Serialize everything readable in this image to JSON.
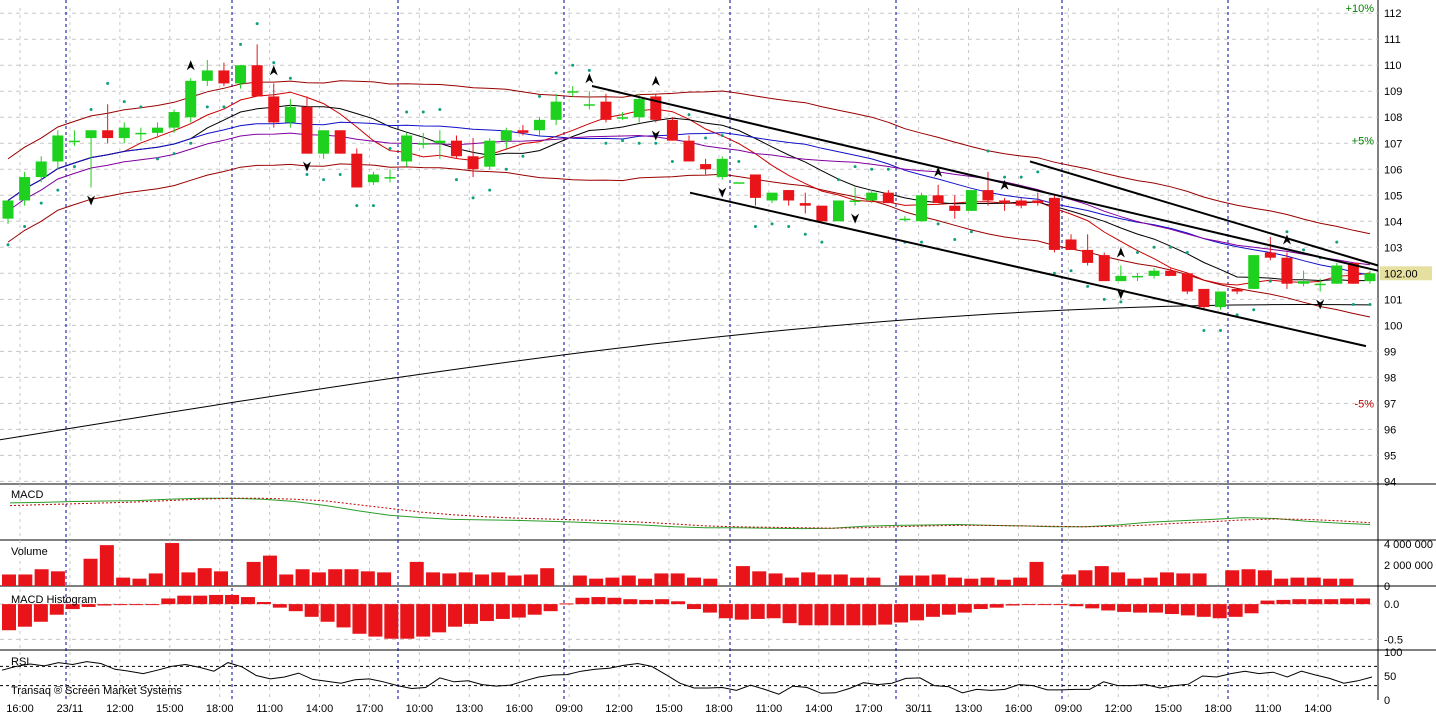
{
  "watermark": "Transaq ® Screen Market Systems",
  "colors": {
    "up": "#1fd11f",
    "down": "#e8141a",
    "grid": "#c8c8c8",
    "vgrid": "#0000a0",
    "price_tag_bg": "#e6e0a0",
    "ma_long": "#000000",
    "pct_pos": "#008000",
    "pct_neg": "#c00000"
  },
  "chart_data": [
    {
      "type": "candlestick",
      "name": "price",
      "x_labels": [
        "16:00",
        "23/11",
        "12:00",
        "15:00",
        "18:00",
        "11:00",
        "14:00",
        "17:00",
        "10:00",
        "13:00",
        "16:00",
        "09:00",
        "12:00",
        "15:00",
        "18:00",
        "11:00",
        "14:00",
        "17:00",
        "30/11",
        "13:00",
        "16:00",
        "09:00",
        "12:00",
        "15:00",
        "18:00",
        "11:00",
        "14:00"
      ],
      "y_ticks": [
        94,
        95,
        96,
        97,
        98,
        99,
        100,
        101,
        102,
        103,
        104,
        105,
        106,
        107,
        108,
        109,
        110,
        111,
        112
      ],
      "ylim": [
        93.9,
        112.2
      ],
      "last_price_label": "102.00",
      "pct_labels": [
        {
          "label": "+10%",
          "value": 112.2,
          "tone": "pos"
        },
        {
          "label": "+5%",
          "value": 107.1,
          "tone": "pos"
        },
        {
          "label": "-5%",
          "value": 97.0,
          "tone": "neg"
        }
      ],
      "candles": [
        {
          "o": 104.1,
          "h": 104.5,
          "l": 103.9,
          "c": 104.8
        },
        {
          "o": 104.8,
          "h": 105.9,
          "l": 104.6,
          "c": 105.7
        },
        {
          "o": 105.7,
          "h": 106.5,
          "l": 105.5,
          "c": 106.3
        },
        {
          "o": 106.3,
          "h": 107.5,
          "l": 106.0,
          "c": 107.3
        },
        {
          "o": 107.1,
          "h": 107.5,
          "l": 106.9,
          "c": 107.1
        },
        {
          "o": 107.2,
          "h": 107.5,
          "l": 105.3,
          "c": 107.5
        },
        {
          "o": 107.5,
          "h": 108.5,
          "l": 107.0,
          "c": 107.2
        },
        {
          "o": 107.2,
          "h": 107.8,
          "l": 107.0,
          "c": 107.6
        },
        {
          "o": 107.4,
          "h": 107.6,
          "l": 107.1,
          "c": 107.4
        },
        {
          "o": 107.4,
          "h": 107.8,
          "l": 107.2,
          "c": 107.6
        },
        {
          "o": 107.6,
          "h": 108.3,
          "l": 107.4,
          "c": 108.2
        },
        {
          "o": 108.0,
          "h": 109.5,
          "l": 107.8,
          "c": 109.4
        },
        {
          "o": 109.4,
          "h": 110.2,
          "l": 109.2,
          "c": 109.8
        },
        {
          "o": 109.8,
          "h": 110.1,
          "l": 109.2,
          "c": 109.3
        },
        {
          "o": 109.3,
          "h": 110.0,
          "l": 109.1,
          "c": 110.0
        },
        {
          "o": 110.0,
          "h": 110.8,
          "l": 108.8,
          "c": 108.8
        },
        {
          "o": 108.8,
          "h": 109.3,
          "l": 107.6,
          "c": 107.8
        },
        {
          "o": 107.8,
          "h": 108.7,
          "l": 107.6,
          "c": 108.4
        },
        {
          "o": 108.4,
          "h": 108.8,
          "l": 106.6,
          "c": 106.6
        },
        {
          "o": 106.6,
          "h": 107.5,
          "l": 106.4,
          "c": 107.5
        },
        {
          "o": 107.5,
          "h": 107.5,
          "l": 106.6,
          "c": 106.6
        },
        {
          "o": 106.6,
          "h": 106.8,
          "l": 105.4,
          "c": 105.3
        },
        {
          "o": 105.5,
          "h": 105.9,
          "l": 105.4,
          "c": 105.8
        },
        {
          "o": 105.7,
          "h": 106.0,
          "l": 105.5,
          "c": 105.7
        },
        {
          "o": 106.3,
          "h": 107.4,
          "l": 106.1,
          "c": 107.3
        },
        {
          "o": 107.0,
          "h": 107.4,
          "l": 106.8,
          "c": 107.0
        },
        {
          "o": 107.0,
          "h": 107.5,
          "l": 106.4,
          "c": 107.1
        },
        {
          "o": 107.1,
          "h": 107.3,
          "l": 106.4,
          "c": 106.5
        },
        {
          "o": 106.5,
          "h": 107.2,
          "l": 105.7,
          "c": 106.0
        },
        {
          "o": 106.1,
          "h": 107.2,
          "l": 106.0,
          "c": 107.1
        },
        {
          "o": 107.1,
          "h": 107.6,
          "l": 106.8,
          "c": 107.5
        },
        {
          "o": 107.5,
          "h": 107.7,
          "l": 107.3,
          "c": 107.4
        },
        {
          "o": 107.5,
          "h": 108.0,
          "l": 107.3,
          "c": 107.9
        },
        {
          "o": 107.9,
          "h": 108.9,
          "l": 107.7,
          "c": 108.6
        },
        {
          "o": 109.0,
          "h": 109.2,
          "l": 108.8,
          "c": 109.0
        },
        {
          "o": 108.5,
          "h": 109.0,
          "l": 108.3,
          "c": 108.5
        },
        {
          "o": 108.6,
          "h": 108.9,
          "l": 107.8,
          "c": 107.9
        },
        {
          "o": 108.0,
          "h": 108.2,
          "l": 107.9,
          "c": 108.0
        },
        {
          "o": 108.0,
          "h": 108.9,
          "l": 107.8,
          "c": 108.7
        },
        {
          "o": 108.8,
          "h": 108.9,
          "l": 107.8,
          "c": 107.9
        },
        {
          "o": 107.9,
          "h": 108.0,
          "l": 107.1,
          "c": 107.1
        },
        {
          "o": 107.1,
          "h": 107.3,
          "l": 106.3,
          "c": 106.3
        },
        {
          "o": 106.2,
          "h": 106.4,
          "l": 105.8,
          "c": 106.0
        },
        {
          "o": 105.7,
          "h": 106.5,
          "l": 105.6,
          "c": 106.4
        },
        {
          "o": 105.5,
          "h": 105.5,
          "l": 105.5,
          "c": 105.5
        },
        {
          "o": 105.8,
          "h": 105.8,
          "l": 104.6,
          "c": 104.9
        },
        {
          "o": 104.8,
          "h": 105.1,
          "l": 104.7,
          "c": 105.1
        },
        {
          "o": 105.2,
          "h": 105.2,
          "l": 104.6,
          "c": 104.8
        },
        {
          "o": 104.7,
          "h": 105.1,
          "l": 104.3,
          "c": 104.6
        },
        {
          "o": 104.6,
          "h": 104.6,
          "l": 104.0,
          "c": 104.0
        },
        {
          "o": 104.0,
          "h": 104.8,
          "l": 104.0,
          "c": 104.8
        },
        {
          "o": 104.8,
          "h": 105.3,
          "l": 104.6,
          "c": 104.8
        },
        {
          "o": 104.8,
          "h": 105.2,
          "l": 104.7,
          "c": 105.1
        },
        {
          "o": 105.1,
          "h": 105.2,
          "l": 104.7,
          "c": 104.7
        },
        {
          "o": 104.1,
          "h": 104.2,
          "l": 104.0,
          "c": 104.1
        },
        {
          "o": 104.0,
          "h": 105.1,
          "l": 104.0,
          "c": 105.0
        },
        {
          "o": 105.0,
          "h": 105.4,
          "l": 104.7,
          "c": 104.7
        },
        {
          "o": 104.6,
          "h": 105.0,
          "l": 104.1,
          "c": 104.4
        },
        {
          "o": 104.4,
          "h": 105.2,
          "l": 104.4,
          "c": 105.2
        },
        {
          "o": 105.2,
          "h": 105.9,
          "l": 104.6,
          "c": 104.8
        },
        {
          "o": 104.8,
          "h": 104.9,
          "l": 104.4,
          "c": 104.7
        },
        {
          "o": 104.8,
          "h": 104.9,
          "l": 104.5,
          "c": 104.6
        },
        {
          "o": 104.8,
          "h": 105.1,
          "l": 104.6,
          "c": 104.7
        },
        {
          "o": 104.9,
          "h": 105.0,
          "l": 102.8,
          "c": 102.9
        },
        {
          "o": 103.3,
          "h": 103.5,
          "l": 102.9,
          "c": 102.9
        },
        {
          "o": 102.9,
          "h": 103.5,
          "l": 102.3,
          "c": 102.4
        },
        {
          "o": 102.7,
          "h": 102.8,
          "l": 101.8,
          "c": 101.7
        },
        {
          "o": 101.7,
          "h": 102.3,
          "l": 101.7,
          "c": 101.9
        },
        {
          "o": 101.9,
          "h": 102.0,
          "l": 101.7,
          "c": 101.9
        },
        {
          "o": 101.9,
          "h": 102.2,
          "l": 101.8,
          "c": 102.1
        },
        {
          "o": 102.1,
          "h": 102.2,
          "l": 101.9,
          "c": 101.9
        },
        {
          "o": 102.0,
          "h": 102.0,
          "l": 101.2,
          "c": 101.3
        },
        {
          "o": 101.4,
          "h": 101.4,
          "l": 100.6,
          "c": 100.7
        },
        {
          "o": 100.7,
          "h": 101.3,
          "l": 100.6,
          "c": 101.3
        },
        {
          "o": 101.4,
          "h": 101.3,
          "l": 101.2,
          "c": 101.3
        },
        {
          "o": 101.4,
          "h": 102.7,
          "l": 101.4,
          "c": 102.7
        },
        {
          "o": 102.8,
          "h": 103.4,
          "l": 102.5,
          "c": 102.6
        },
        {
          "o": 102.6,
          "h": 102.8,
          "l": 101.4,
          "c": 101.6
        },
        {
          "o": 101.6,
          "h": 102.1,
          "l": 101.5,
          "c": 101.7
        },
        {
          "o": 101.6,
          "h": 101.8,
          "l": 101.3,
          "c": 101.6
        },
        {
          "o": 101.6,
          "h": 102.4,
          "l": 101.6,
          "c": 102.3
        },
        {
          "o": 102.4,
          "h": 102.4,
          "l": 101.6,
          "c": 101.6
        },
        {
          "o": 101.7,
          "h": 102.1,
          "l": 101.6,
          "c": 102.0
        }
      ],
      "trendlines": [
        {
          "x0": 592,
          "y0": 109.2,
          "x1": 1378,
          "y1": 102.1
        },
        {
          "x0": 690,
          "y0": 105.1,
          "x1": 1366,
          "y1": 99.2
        },
        {
          "x0": 1030,
          "y0": 106.3,
          "x1": 1378,
          "y1": 102.3
        }
      ],
      "fractal_up_at": [
        11,
        16,
        35,
        39,
        56,
        60,
        67,
        77
      ],
      "fractal_down_at": [
        5,
        18,
        39,
        43,
        51,
        67,
        79,
        90
      ]
    },
    {
      "type": "line",
      "name": "MACD",
      "label": "MACD",
      "series": [
        {
          "name": "macd",
          "values": [
            0.72,
            0.73,
            0.75,
            0.76,
            0.77,
            0.8,
            0.82,
            0.82,
            0.8,
            0.75,
            0.66,
            0.55,
            0.45,
            0.4,
            0.36,
            0.35,
            0.34,
            0.32,
            0.3,
            0.27,
            0.24,
            0.2,
            0.18,
            0.18,
            0.17,
            0.16,
            0.17,
            0.21,
            0.23,
            0.24,
            0.25,
            0.23,
            0.22,
            0.2,
            0.2,
            0.24,
            0.3,
            0.33,
            0.36,
            0.4,
            0.38,
            0.32,
            0.28,
            0.25
          ]
        },
        {
          "name": "signal",
          "values": [
            0.66,
            0.68,
            0.7,
            0.72,
            0.74,
            0.77,
            0.8,
            0.82,
            0.82,
            0.8,
            0.76,
            0.68,
            0.6,
            0.52,
            0.46,
            0.42,
            0.39,
            0.37,
            0.35,
            0.33,
            0.3,
            0.26,
            0.22,
            0.2,
            0.19,
            0.18,
            0.17,
            0.18,
            0.2,
            0.22,
            0.23,
            0.23,
            0.22,
            0.21,
            0.2,
            0.21,
            0.24,
            0.28,
            0.31,
            0.35,
            0.37,
            0.36,
            0.33,
            0.29
          ]
        }
      ]
    },
    {
      "type": "bar",
      "name": "Volume",
      "label": "Volume",
      "y_ticks": [
        {
          "value": 0,
          "label": "0"
        },
        {
          "value": 2000000,
          "label": "2 000 000"
        },
        {
          "value": 4000000,
          "label": "4 000 000"
        }
      ],
      "ylim": [
        0,
        4200000
      ],
      "values": [
        1100000,
        1100000,
        1600000,
        1400000,
        0,
        2600000,
        3900000,
        800000,
        700000,
        1200000,
        4100000,
        1300000,
        1700000,
        1400000,
        0,
        2300000,
        2900000,
        1100000,
        1600000,
        1300000,
        1600000,
        1600000,
        1400000,
        1300000,
        0,
        2300000,
        1300000,
        1200000,
        1300000,
        1100000,
        1300000,
        1000000,
        1100000,
        1700000,
        0,
        1000000,
        700000,
        800000,
        1000000,
        700000,
        1200000,
        1200000,
        800000,
        700000,
        0,
        1900000,
        1400000,
        1200000,
        800000,
        1300000,
        1100000,
        1100000,
        800000,
        800000,
        0,
        1000000,
        1000000,
        1100000,
        800000,
        700000,
        800000,
        600000,
        800000,
        2300000,
        0,
        1100000,
        1500000,
        1900000,
        1300000,
        700000,
        800000,
        1300000,
        1200000,
        1200000,
        0,
        1500000,
        1600000,
        1500000,
        700000,
        800000,
        800000,
        700000,
        700000,
        0
      ],
      "values_unit": "shares"
    },
    {
      "type": "bar",
      "name": "MACD Histogram",
      "label": "MACD Histogram",
      "y_ticks": [
        {
          "value": 0.0,
          "label": "0.0"
        },
        {
          "value": -0.5,
          "label": "-0.5"
        }
      ],
      "ylim": [
        -0.65,
        0.2
      ],
      "values": [
        -0.37,
        -0.32,
        -0.25,
        -0.15,
        -0.07,
        -0.04,
        -0.02,
        -0.01,
        -0.01,
        -0.01,
        0.08,
        0.12,
        0.12,
        0.13,
        0.13,
        0.1,
        0.03,
        -0.05,
        -0.1,
        -0.18,
        -0.25,
        -0.33,
        -0.42,
        -0.46,
        -0.49,
        -0.49,
        -0.46,
        -0.4,
        -0.32,
        -0.28,
        -0.24,
        -0.21,
        -0.19,
        -0.15,
        -0.1,
        0.01,
        0.09,
        0.1,
        0.09,
        0.07,
        0.06,
        0.07,
        0.04,
        -0.07,
        -0.12,
        -0.2,
        -0.22,
        -0.21,
        -0.2,
        -0.27,
        -0.3,
        -0.3,
        -0.3,
        -0.3,
        -0.3,
        -0.29,
        -0.26,
        -0.23,
        -0.18,
        -0.15,
        -0.12,
        -0.07,
        -0.05,
        -0.02,
        -0.01,
        0.0,
        0.0,
        -0.03,
        -0.06,
        -0.09,
        -0.11,
        -0.12,
        -0.12,
        -0.14,
        -0.16,
        -0.18,
        -0.2,
        -0.18,
        -0.13,
        0.05,
        0.06,
        0.07,
        0.07,
        0.07,
        0.08,
        0.08
      ]
    },
    {
      "type": "line",
      "name": "RSI",
      "label": "RSI",
      "y_ticks": [
        {
          "value": 0,
          "label": "0"
        },
        {
          "value": 50,
          "label": "50"
        },
        {
          "value": 100,
          "label": "100"
        }
      ],
      "ylim": [
        0,
        100
      ],
      "values": [
        62,
        70,
        75,
        71,
        78,
        74,
        80,
        76,
        64,
        60,
        55,
        62,
        70,
        74,
        68,
        60,
        78,
        69,
        51,
        44,
        48,
        56,
        43,
        39,
        35,
        42,
        44,
        38,
        30,
        24,
        26,
        46,
        38,
        40,
        32,
        29,
        31,
        40,
        48,
        52,
        53,
        60,
        64,
        66,
        72,
        76,
        70,
        53,
        35,
        25,
        25,
        26,
        20,
        31,
        22,
        12,
        29,
        26,
        14,
        15,
        24,
        36,
        32,
        35,
        45,
        46,
        30,
        28,
        15,
        22,
        20,
        22,
        32,
        30,
        21,
        21,
        22,
        22,
        38,
        30,
        30,
        32,
        25,
        30,
        33,
        50,
        48,
        55,
        60,
        55,
        58,
        48,
        60,
        52,
        45,
        35,
        40,
        48
      ]
    }
  ]
}
